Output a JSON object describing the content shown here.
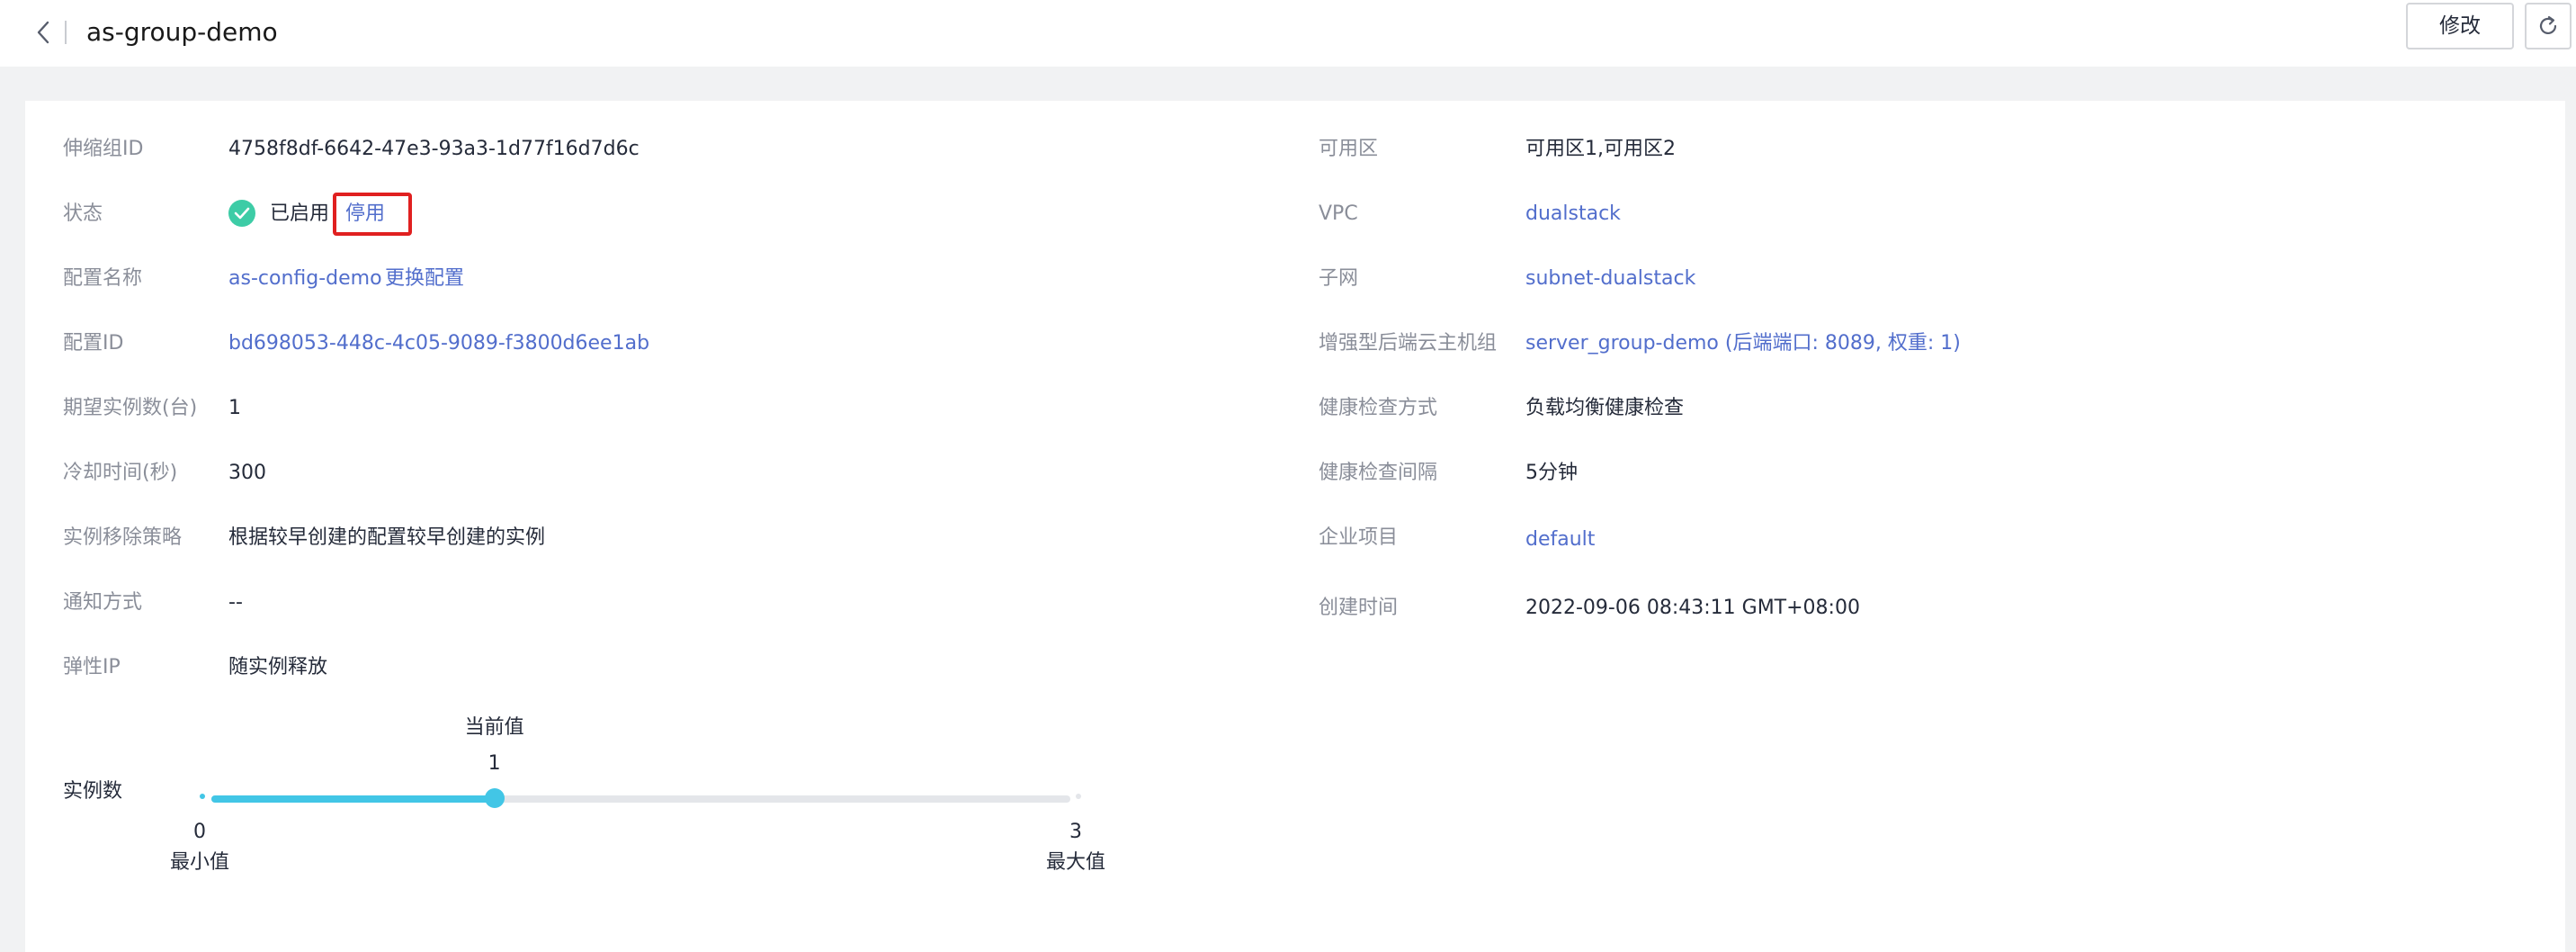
{
  "header": {
    "title": "as-group-demo",
    "edit_label": "修改",
    "back_icon": "chevron-left-icon",
    "refresh_icon": "refresh-icon"
  },
  "left": {
    "group_id": {
      "label": "伸缩组ID",
      "value": "4758f8df-6642-47e3-93a3-1d77f16d7d6c"
    },
    "status": {
      "label": "状态",
      "value": "已启用",
      "action": "停用",
      "icon": "check-circle-icon"
    },
    "config_name": {
      "label": "配置名称",
      "value": "as-config-demo",
      "action": "更换配置"
    },
    "config_id": {
      "label": "配置ID",
      "value": "bd698053-448c-4c05-9089-f3800d6ee1ab"
    },
    "desired": {
      "label": "期望实例数(台)",
      "value": "1"
    },
    "cooldown": {
      "label": "冷却时间(秒)",
      "value": "300"
    },
    "removal": {
      "label": "实例移除策略",
      "value": "根据较早创建的配置较早创建的实例"
    },
    "notify": {
      "label": "通知方式",
      "value": "--"
    },
    "eip": {
      "label": "弹性IP",
      "value": "随实例释放"
    }
  },
  "right": {
    "az": {
      "label": "可用区",
      "value": "可用区1,可用区2"
    },
    "vpc": {
      "label": "VPC",
      "value": "dualstack"
    },
    "subnet": {
      "label": "子网",
      "value": "subnet-dualstack"
    },
    "backend": {
      "label": "增强型后端云主机组",
      "value": "server_group-demo (后端端口: 8089, 权重: 1)"
    },
    "hc_method": {
      "label": "健康检查方式",
      "value": "负载均衡健康检查"
    },
    "hc_interval": {
      "label": "健康检查间隔",
      "value": "5分钟"
    },
    "project": {
      "label": "企业项目",
      "value": "default"
    },
    "created": {
      "label": "创建时间",
      "value": "2022-09-06 08:43:11 GMT+08:00"
    }
  },
  "instances": {
    "label": "实例数",
    "current_label": "当前值",
    "current": 1,
    "current_text": "1",
    "min": 0,
    "min_text": "0",
    "min_label": "最小值",
    "max": 3,
    "max_text": "3",
    "max_label": "最大值"
  },
  "colors": {
    "link": "#526ecc",
    "success": "#3dcca6",
    "slider": "#42c6e6",
    "highlight": "#e02020"
  }
}
